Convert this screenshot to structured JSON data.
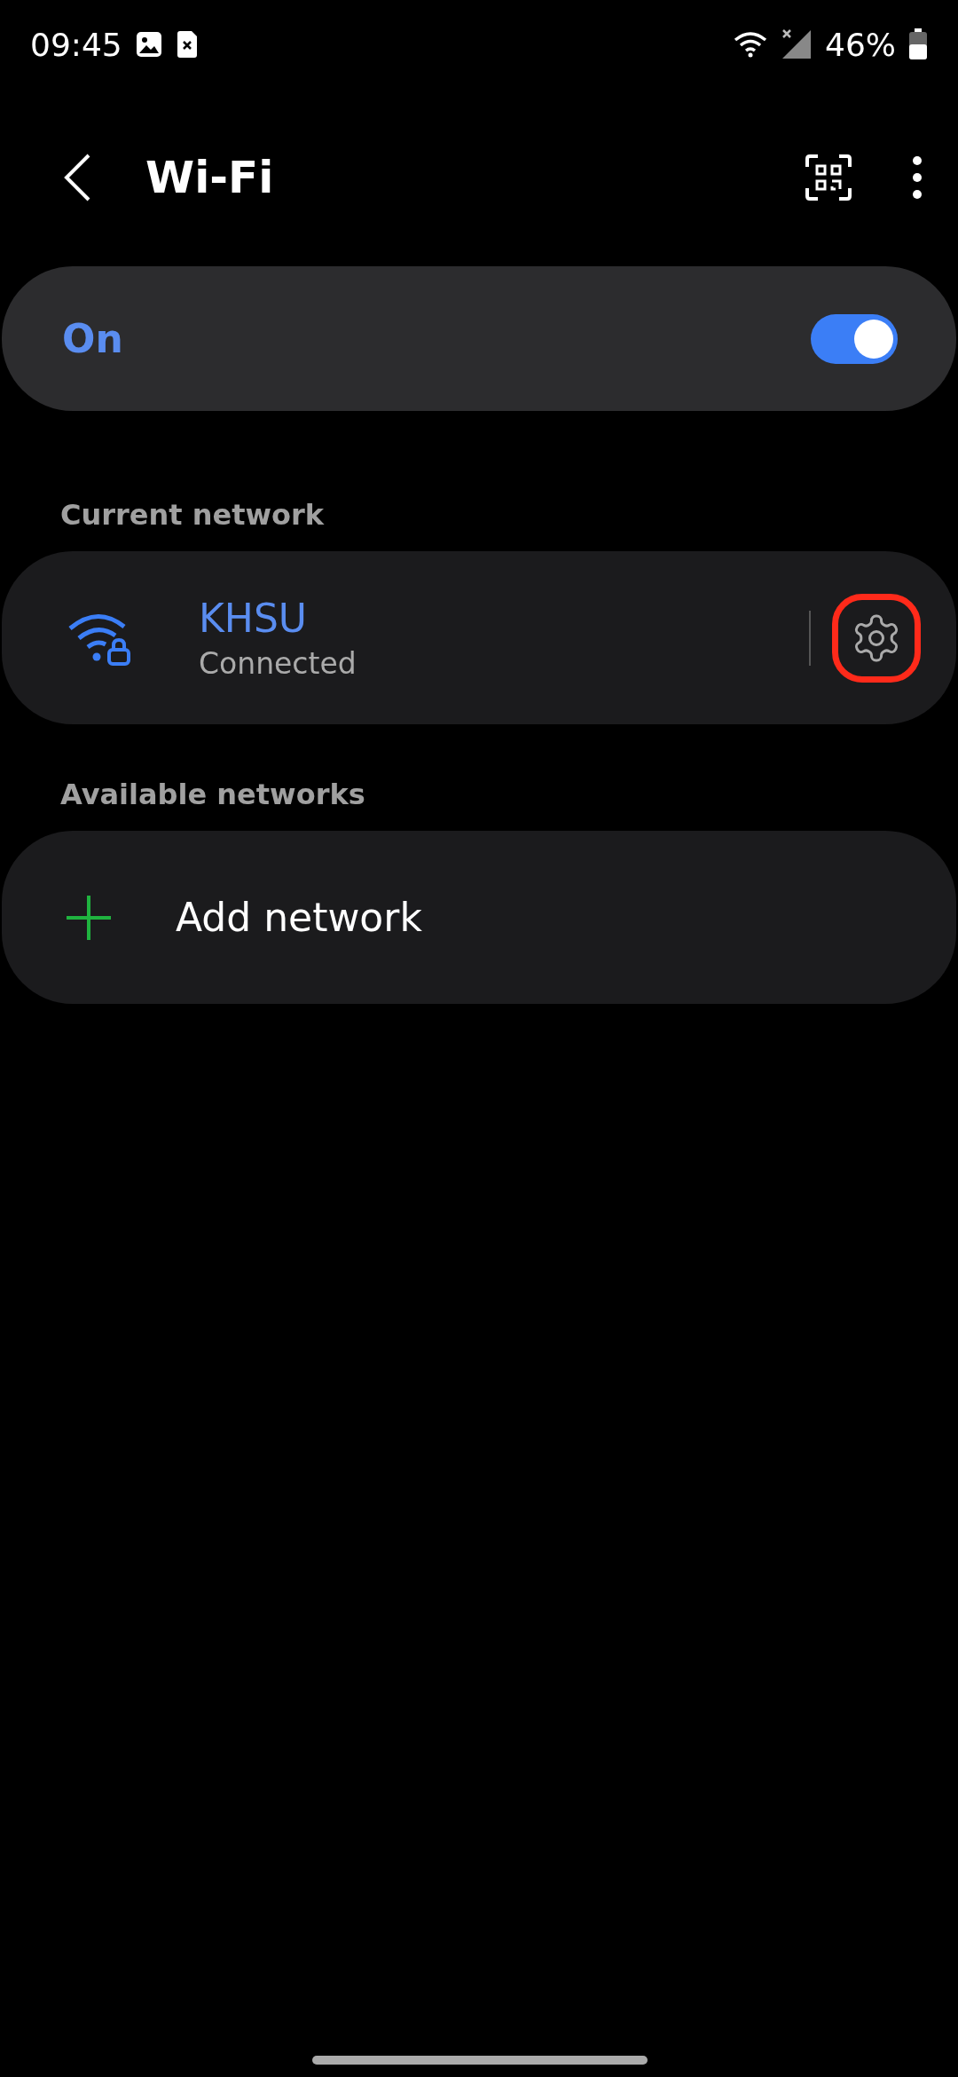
{
  "status_bar": {
    "time": "09:45",
    "battery": "46%"
  },
  "header": {
    "title": "Wi-Fi"
  },
  "master_switch": {
    "label": "On",
    "on": true
  },
  "sections": [
    {
      "title": "Current network",
      "kind": "current",
      "network": {
        "name": "KHSU",
        "status": "Connected",
        "settings_highlighted": true
      }
    },
    {
      "title": "Available networks",
      "kind": "add",
      "label": "Add network"
    }
  ]
}
